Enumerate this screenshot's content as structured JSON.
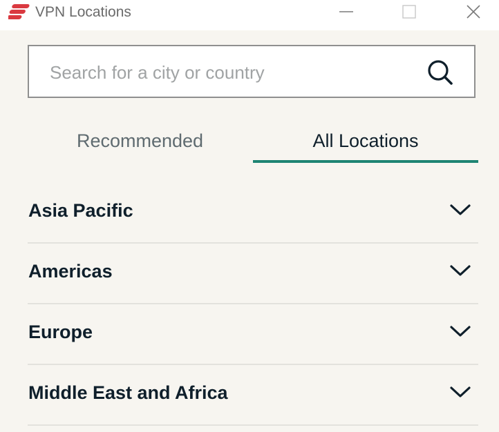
{
  "window": {
    "title": "VPN Locations"
  },
  "search": {
    "placeholder": "Search for a city or country",
    "value": ""
  },
  "tabs": [
    {
      "label": "Recommended",
      "active": false
    },
    {
      "label": "All Locations",
      "active": true
    }
  ],
  "regions": [
    {
      "label": "Asia Pacific",
      "expanded": false
    },
    {
      "label": "Americas",
      "expanded": false
    },
    {
      "label": "Europe",
      "expanded": false
    },
    {
      "label": "Middle East and Africa",
      "expanded": false
    }
  ],
  "colors": {
    "accent": "#1e8473",
    "logo_red": "#da3940",
    "text_dark": "#0f1f2b",
    "background": "#f7f5f0"
  },
  "icons": {
    "logo": "expressvpn-logo-icon",
    "minimize": "minimize-icon",
    "maximize": "maximize-icon",
    "close": "close-icon",
    "search": "search-icon",
    "chevron": "chevron-down-icon"
  }
}
